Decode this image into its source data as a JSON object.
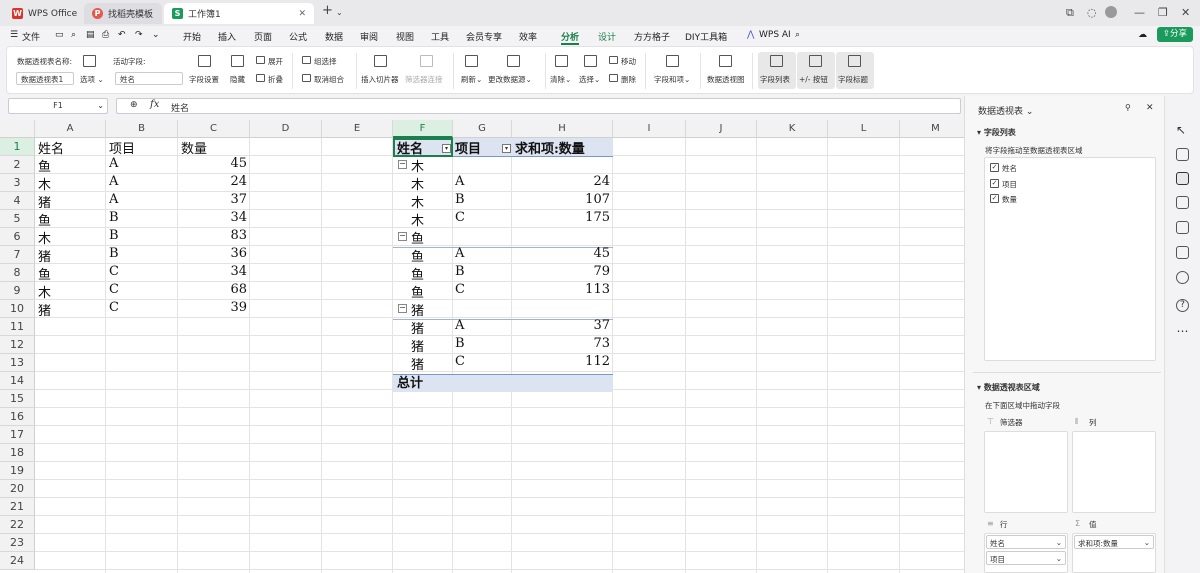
{
  "tabs": [
    {
      "label": "WPS Office"
    },
    {
      "label": "找稻壳模板"
    },
    {
      "label": "工作簿1"
    }
  ],
  "menu": {
    "file": "文件",
    "items": [
      "开始",
      "插入",
      "页面",
      "公式",
      "数据",
      "审阅",
      "视图",
      "工具",
      "会员专享",
      "效率",
      "分析",
      "设计",
      "方方格子",
      "DIY工具箱",
      "WPS AI"
    ],
    "active": "分析",
    "share": "分享"
  },
  "ribbon": {
    "pivot_name_label": "数据透视表名称:",
    "pivot_name_value": "数据透视表1",
    "options": "选项",
    "active_field_label": "活动字段:",
    "active_field_value": "姓名",
    "field_settings": "字段设置",
    "hide": "隐藏",
    "expand": "展开",
    "collapse": "折叠",
    "group_select": "组选择",
    "ungroup": "取消组合",
    "insert_slicer": "插入切片器",
    "filter_connections": "筛选器连接",
    "refresh": "刷新",
    "change_source": "更改数据源",
    "clear": "清除",
    "select": "选择",
    "move": "移动",
    "delete": "删除",
    "fields_items": "字段和项",
    "pivot_chart": "数据透视图",
    "field_list": "字段列表",
    "buttons": "+/- 按钮",
    "field_headers": "字段标题"
  },
  "formula_bar": {
    "cell_ref": "F1",
    "content": "姓名"
  },
  "columns": [
    "A",
    "B",
    "C",
    "D",
    "E",
    "F",
    "G",
    "H",
    "I",
    "J",
    "K",
    "L",
    "M"
  ],
  "rows": [
    "1",
    "2",
    "3",
    "4",
    "5",
    "6",
    "7",
    "8",
    "9",
    "10",
    "11",
    "12",
    "13",
    "14",
    "15",
    "16",
    "17",
    "18",
    "19",
    "20",
    "21",
    "22",
    "23",
    "24"
  ],
  "source": {
    "headers": [
      "姓名",
      "项目",
      "数量"
    ],
    "rows": [
      [
        "鱼",
        "A",
        "45"
      ],
      [
        "木",
        "A",
        "24"
      ],
      [
        "猪",
        "A",
        "37"
      ],
      [
        "鱼",
        "B",
        "34"
      ],
      [
        "木",
        "B",
        "83"
      ],
      [
        "猪",
        "B",
        "36"
      ],
      [
        "鱼",
        "C",
        "34"
      ],
      [
        "木",
        "C",
        "68"
      ],
      [
        "猪",
        "C",
        "39"
      ]
    ]
  },
  "pivot": {
    "headers": [
      "姓名",
      "项目",
      "求和项:数量"
    ],
    "groups": [
      {
        "name": "木",
        "rows": [
          [
            "木",
            "A",
            "24"
          ],
          [
            "木",
            "B",
            "107"
          ],
          [
            "木",
            "C",
            "175"
          ]
        ]
      },
      {
        "name": "鱼",
        "rows": [
          [
            "鱼",
            "A",
            "45"
          ],
          [
            "鱼",
            "B",
            "79"
          ],
          [
            "鱼",
            "C",
            "113"
          ]
        ]
      },
      {
        "name": "猪",
        "rows": [
          [
            "猪",
            "A",
            "37"
          ],
          [
            "猪",
            "B",
            "73"
          ],
          [
            "猪",
            "C",
            "112"
          ]
        ]
      }
    ],
    "total_label": "总计"
  },
  "panel": {
    "title": "数据透视表",
    "field_list_title": "字段列表",
    "field_list_hint": "将字段拖动至数据透视表区域",
    "fields": [
      "姓名",
      "项目",
      "数量"
    ],
    "area_title": "数据透视表区域",
    "area_hint": "在下面区域中拖动字段",
    "filter_label": "筛选器",
    "col_label": "列",
    "row_label": "行",
    "value_label": "值",
    "row_fields": [
      "姓名",
      "项目"
    ],
    "value_fields": [
      "求和项:数量"
    ]
  }
}
